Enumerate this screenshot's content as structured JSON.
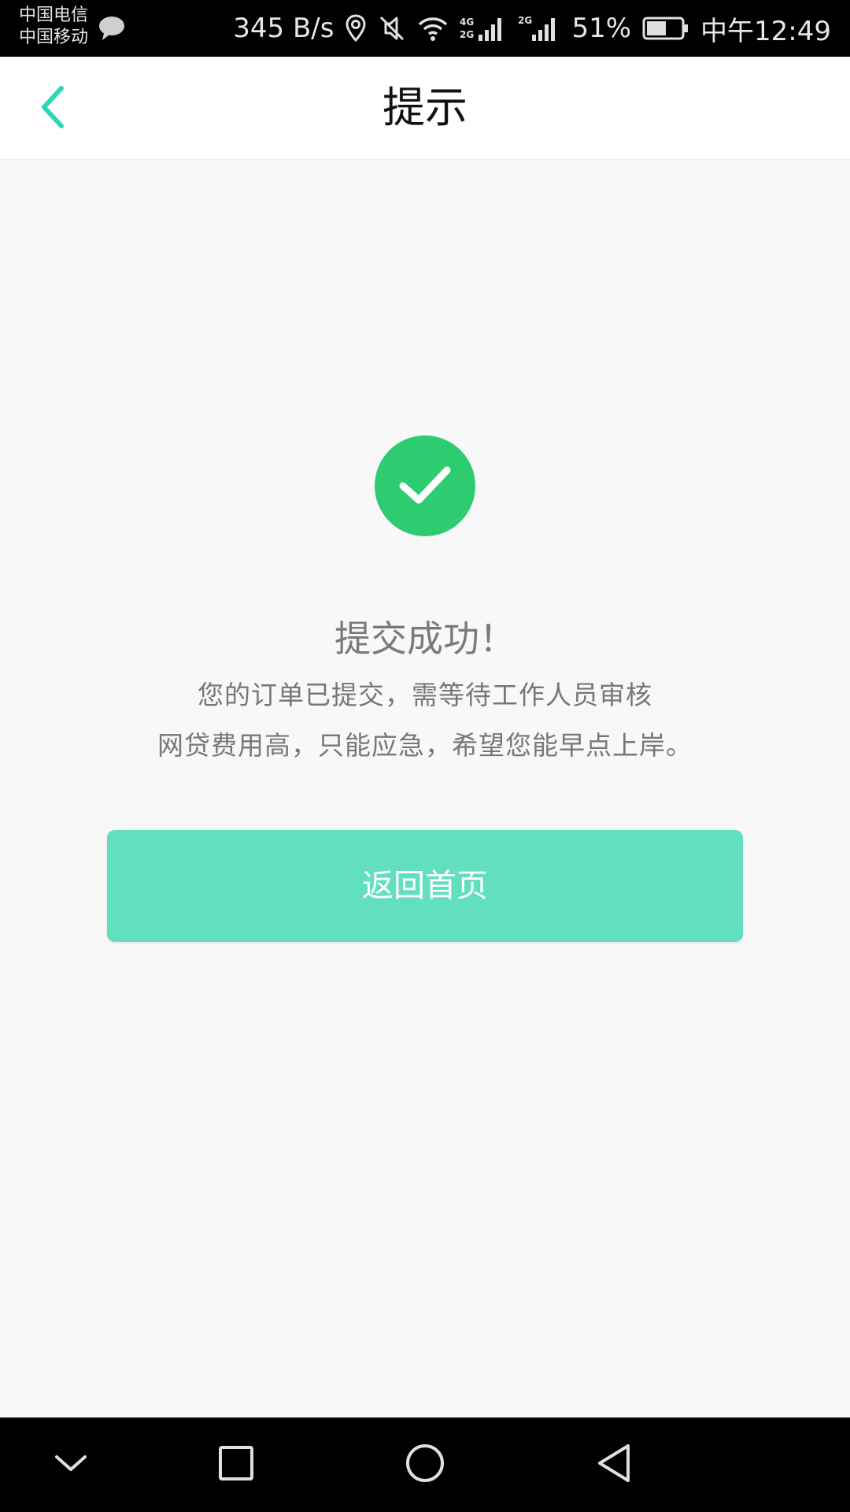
{
  "status_bar": {
    "carrier_1": "中国电信",
    "carrier_2": "中国移动",
    "net_speed": "345 B/s",
    "battery_pct": "51%",
    "time": "中午12:49",
    "icons": [
      "message-icon",
      "location-icon",
      "mute-icon",
      "wifi-icon",
      "signal-4g-icon",
      "signal-2g-icon",
      "battery-icon"
    ]
  },
  "header": {
    "title": "提示",
    "back_icon": "chevron-left-icon"
  },
  "main": {
    "status_icon": "check-circle-icon",
    "title": "提交成功！",
    "message_line_1": "您的订单已提交，需等待工作人员审核",
    "message_line_2": "网贷费用高，只能应急，希望您能早点上岸。",
    "button_label": "返回首页"
  },
  "nav_bar": {
    "buttons": [
      "chevron-down-icon",
      "recent-apps-icon",
      "home-icon",
      "back-icon"
    ]
  },
  "colors": {
    "accent": "#62dfbf",
    "success": "#2ecc71",
    "back_arrow": "#2ed6b3"
  }
}
